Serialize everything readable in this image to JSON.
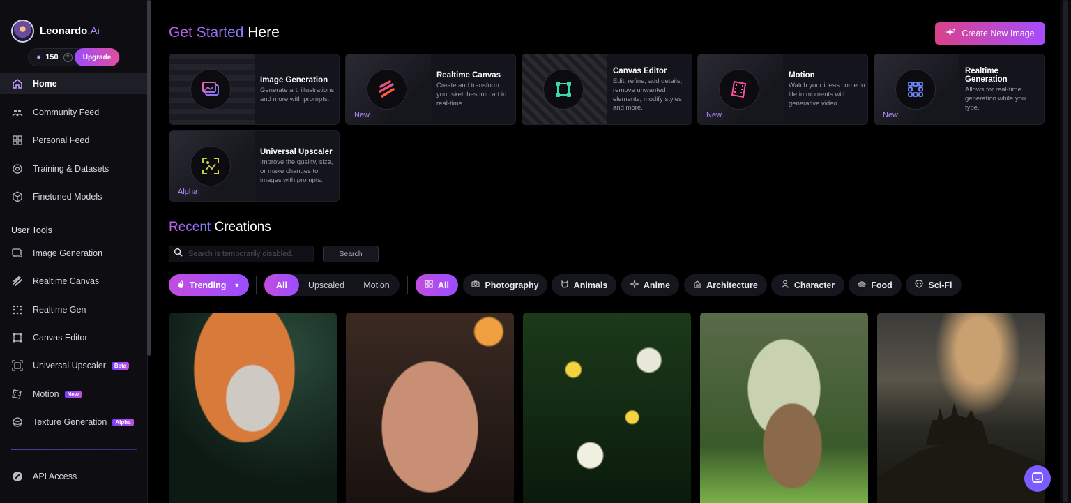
{
  "brand": {
    "name": "Leonardo",
    "suffix": ".Ai"
  },
  "credits": {
    "count": "150",
    "upgrade_label": "Upgrade"
  },
  "sidebar": {
    "items": [
      {
        "label": "Home",
        "icon": "home-icon"
      },
      {
        "label": "Community Feed",
        "icon": "community-icon"
      },
      {
        "label": "Personal Feed",
        "icon": "grid-icon"
      },
      {
        "label": "Training & Datasets",
        "icon": "training-icon"
      },
      {
        "label": "Finetuned Models",
        "icon": "cube-icon"
      }
    ],
    "section_label": "User Tools",
    "tools": [
      {
        "label": "Image Generation",
        "icon": "image-gen-icon",
        "badge": ""
      },
      {
        "label": "Realtime Canvas",
        "icon": "brush-icon",
        "badge": ""
      },
      {
        "label": "Realtime Gen",
        "icon": "realtime-gen-icon",
        "badge": ""
      },
      {
        "label": "Canvas Editor",
        "icon": "canvas-icon",
        "badge": ""
      },
      {
        "label": "Universal Upscaler",
        "icon": "upscaler-icon",
        "badge": "Beta"
      },
      {
        "label": "Motion",
        "icon": "motion-icon",
        "badge": "New"
      },
      {
        "label": "Texture Generation",
        "icon": "texture-icon",
        "badge": "Alpha"
      }
    ],
    "api_label": "API Access"
  },
  "header": {
    "title_accent": "Get Started",
    "title_rest": " Here",
    "create_button": "Create New Image"
  },
  "feature_cards": [
    {
      "title": "Image Generation",
      "desc": "Generate art, illustrations and more with prompts.",
      "tag": ""
    },
    {
      "title": "Realtime Canvas",
      "desc": "Create and transform your sketches into art in real-time.",
      "tag": "New"
    },
    {
      "title": "Canvas Editor",
      "desc": "Edit, refine, add details, remove unwanted elements, modify styles and more.",
      "tag": ""
    },
    {
      "title": "Motion",
      "desc": "Watch your ideas come to life in moments with generative video.",
      "tag": "New"
    },
    {
      "title": "Realtime Generation",
      "desc": "Allows for real-time generation while you type.",
      "tag": "New"
    },
    {
      "title": "Universal Upscaler",
      "desc": "Improve the quality, size, or make changes to images with prompts.",
      "tag": "Alpha"
    }
  ],
  "recent": {
    "title_accent": "Recent",
    "title_rest": " Creations",
    "search_placeholder": "Search is temporarily disabled.",
    "search_button": "Search"
  },
  "filters": {
    "sort": "Trending",
    "types": [
      "All",
      "Upscaled",
      "Motion"
    ],
    "categories": [
      {
        "label": "All",
        "icon": "grid-icon"
      },
      {
        "label": "Photography",
        "icon": "camera-icon"
      },
      {
        "label": "Animals",
        "icon": "animal-icon"
      },
      {
        "label": "Anime",
        "icon": "sparkle-icon"
      },
      {
        "label": "Architecture",
        "icon": "building-icon"
      },
      {
        "label": "Character",
        "icon": "person-icon"
      },
      {
        "label": "Food",
        "icon": "food-icon"
      },
      {
        "label": "Sci-Fi",
        "icon": "alien-icon"
      }
    ]
  },
  "colors": {
    "accent_purple": "#9b4dff",
    "accent_pink": "#e24d9c",
    "background": "#000000",
    "sidebar": "#0d0d12"
  }
}
